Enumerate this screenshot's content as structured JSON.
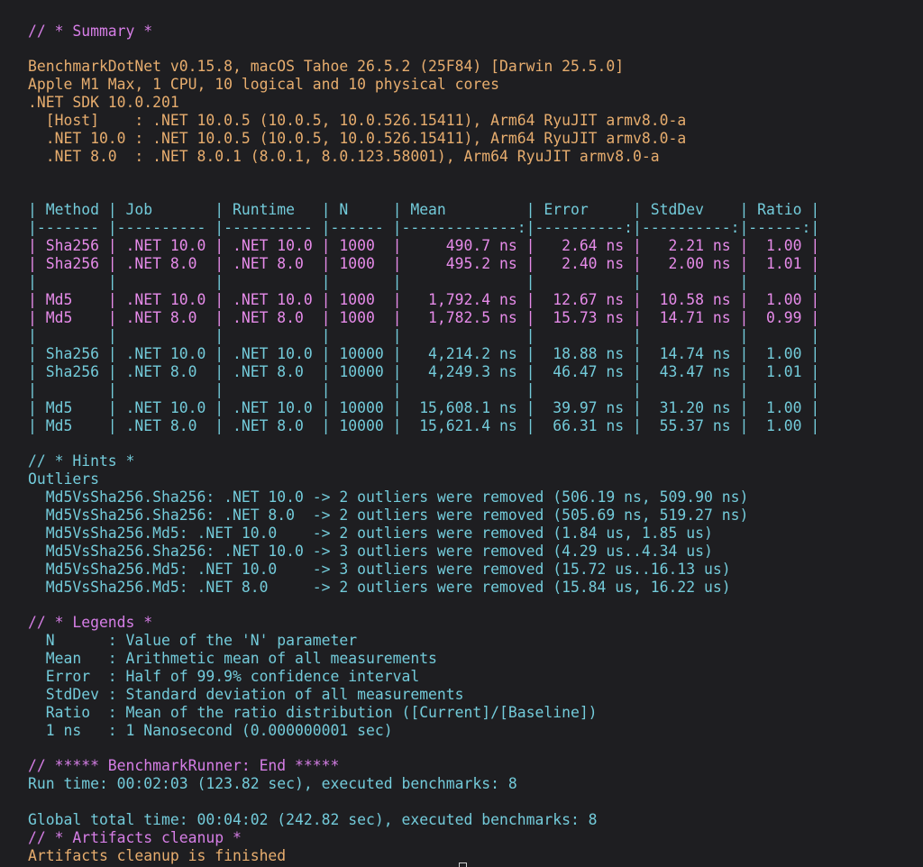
{
  "summary_header": "// * Summary *",
  "environment": [
    "BenchmarkDotNet v0.15.8, macOS Tahoe 26.5.2 (25F84) [Darwin 25.5.0]",
    "Apple M1 Max, 1 CPU, 10 logical and 10 physical cores",
    ".NET SDK 10.0.201",
    "  [Host]    : .NET 10.0.5 (10.0.5, 10.0.526.15411), Arm64 RyuJIT armv8.0-a",
    "  .NET 10.0 : .NET 10.0.5 (10.0.5, 10.0.526.15411), Arm64 RyuJIT armv8.0-a",
    "  .NET 8.0  : .NET 8.0.1 (8.0.1, 8.0.123.58001), Arm64 RyuJIT armv8.0-a"
  ],
  "results_table": {
    "header": "| Method | Job       | Runtime   | N     | Mean         | Error     | StdDev    | Ratio |",
    "separator": "|------- |---------- |---------- |------ |-------------:|----------:|----------:|------:|",
    "blank_row": "|        |           |           |       |              |           |           |       |",
    "rows": [
      "| Sha256 | .NET 10.0 | .NET 10.0 | 1000  |     490.7 ns |   2.64 ns |   2.21 ns |  1.00 |",
      "| Sha256 | .NET 8.0  | .NET 8.0  | 1000  |     495.2 ns |   2.40 ns |   2.00 ns |  1.01 |",
      "| Md5    | .NET 10.0 | .NET 10.0 | 1000  |   1,792.4 ns |  12.67 ns |  10.58 ns |  1.00 |",
      "| Md5    | .NET 8.0  | .NET 8.0  | 1000  |   1,782.5 ns |  15.73 ns |  14.71 ns |  0.99 |",
      "| Sha256 | .NET 10.0 | .NET 10.0 | 10000 |   4,214.2 ns |  18.88 ns |  14.74 ns |  1.00 |",
      "| Sha256 | .NET 8.0  | .NET 8.0  | 10000 |   4,249.3 ns |  46.47 ns |  43.47 ns |  1.01 |",
      "| Md5    | .NET 10.0 | .NET 10.0 | 10000 |  15,608.1 ns |  39.97 ns |  31.20 ns |  1.00 |",
      "| Md5    | .NET 8.0  | .NET 8.0  | 10000 |  15,621.4 ns |  66.31 ns |  55.37 ns |  1.00 |"
    ]
  },
  "hints": {
    "header": "// * Hints *",
    "title": "Outliers",
    "lines": [
      "  Md5VsSha256.Sha256: .NET 10.0 -> 2 outliers were removed (506.19 ns, 509.90 ns)",
      "  Md5VsSha256.Sha256: .NET 8.0  -> 2 outliers were removed (505.69 ns, 519.27 ns)",
      "  Md5VsSha256.Md5: .NET 10.0    -> 2 outliers were removed (1.84 us, 1.85 us)",
      "  Md5VsSha256.Sha256: .NET 10.0 -> 3 outliers were removed (4.29 us..4.34 us)",
      "  Md5VsSha256.Md5: .NET 10.0    -> 3 outliers were removed (15.72 us..16.13 us)",
      "  Md5VsSha256.Md5: .NET 8.0     -> 2 outliers were removed (15.84 us, 16.22 us)"
    ]
  },
  "legends": {
    "header": "// * Legends *",
    "lines": [
      "  N      : Value of the 'N' parameter",
      "  Mean   : Arithmetic mean of all measurements",
      "  Error  : Half of 99.9% confidence interval",
      "  StdDev : Standard deviation of all measurements",
      "  Ratio  : Mean of the ratio distribution ([Current]/[Baseline])",
      "  1 ns   : 1 Nanosecond (0.000000001 sec)"
    ]
  },
  "runner": {
    "header": "// ***** BenchmarkRunner: End *****",
    "run_time": "Run time: 00:02:03 (123.82 sec), executed benchmarks: 8",
    "global_time": "Global total time: 00:04:02 (242.82 sec), executed benchmarks: 8"
  },
  "cleanup": {
    "header": "// * Artifacts cleanup *",
    "message": "Artifacts cleanup is finished"
  },
  "colors": {
    "background": "#1e1e21",
    "comment_header": "#d67ee6",
    "environment_text": "#e7ad6e",
    "table_and_info": "#73cbda",
    "table_values": "#e68be9"
  }
}
